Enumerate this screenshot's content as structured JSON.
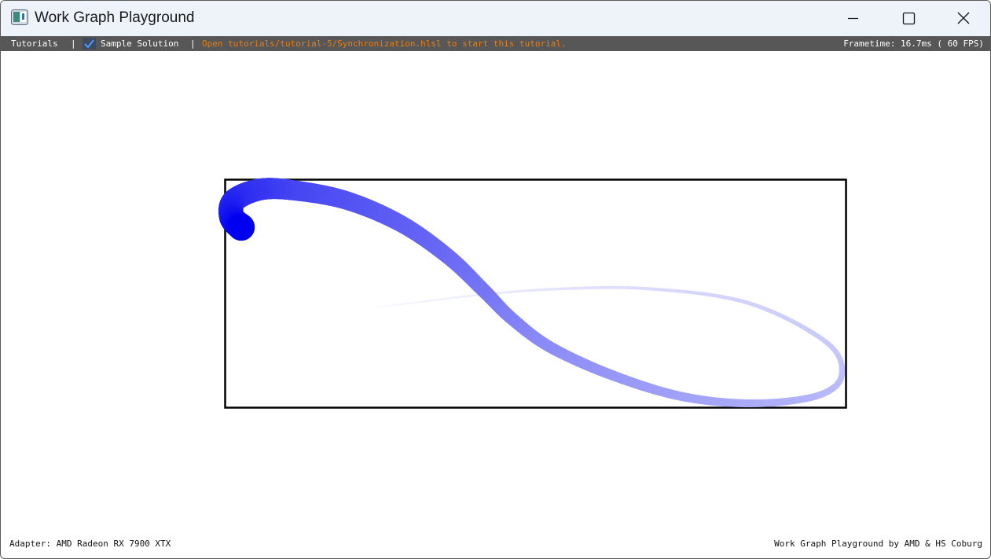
{
  "window": {
    "title": "Work Graph Playground"
  },
  "menubar": {
    "tutorials_label": "Tutorials",
    "separator": "|",
    "sample_solution_label": "Sample Solution",
    "sample_solution_checked": true,
    "open_hint": "Open tutorials/tutorial-5/Synchronization.hlsl to start this tutorial.",
    "frametime": "Frametime:  16.7ms ( 60 FPS)"
  },
  "footer": {
    "adapter": "Adapter: AMD Radeon RX 7900 XTX",
    "credits": "Work Graph Playground by AMD & HS Coburg"
  },
  "colors": {
    "titlebar_bg": "#eef2f9",
    "menubar_bg": "#575757",
    "hint_text": "#e67e14",
    "trail_head": "#0000f0",
    "trail_tail": "#ffffff",
    "frame_border": "#000000"
  },
  "icons": {
    "app": "app-icon",
    "minimize": "minimize-icon",
    "maximize": "maximize-icon",
    "close": "close-icon",
    "checkbox": "checkmark-icon"
  }
}
